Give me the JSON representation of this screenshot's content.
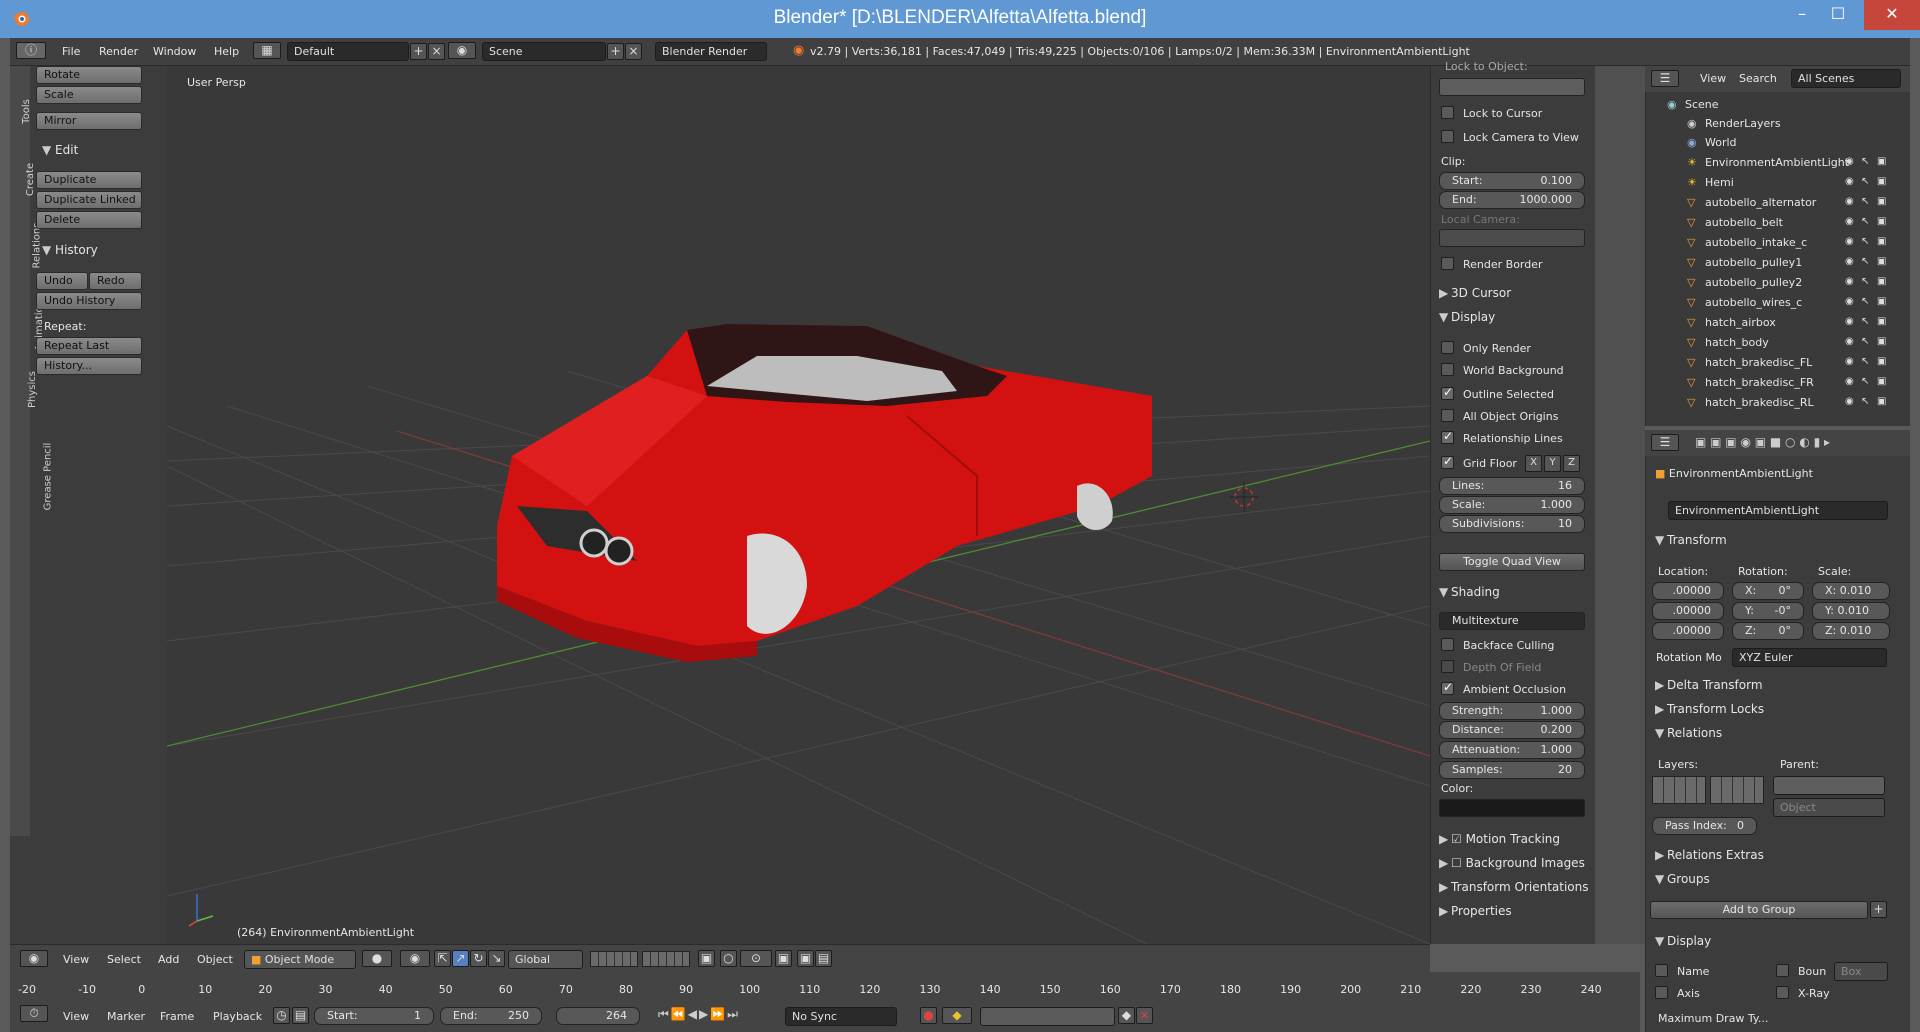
{
  "window": {
    "title": "Blender* [D:\\BLENDER\\Alfetta\\Alfetta.blend]"
  },
  "menu": {
    "items": [
      "File",
      "Render",
      "Window",
      "Help"
    ],
    "layout": "Default",
    "scene": "Scene",
    "engine": "Blender Render",
    "stats": "v2.79 | Verts:36,181 | Faces:47,049 | Tris:49,225 | Objects:0/106 | Lamps:0/2 | Mem:36.33M | EnvironmentAmbientLight"
  },
  "toolshelf": {
    "tabs": [
      "Tools",
      "Create",
      "Relations",
      "Animation",
      "Physics",
      "Grease Pencil"
    ],
    "transform_buttons": [
      "Rotate",
      "Scale"
    ],
    "mirror": "Mirror",
    "edit_header": "Edit",
    "edit_buttons": [
      "Duplicate",
      "Duplicate Linked",
      "Delete"
    ],
    "history_header": "History",
    "undo": "Undo",
    "redo": "Redo",
    "undo_history": "Undo History",
    "repeat_label": "Repeat:",
    "repeat_last": "Repeat Last",
    "history_more": "History..."
  },
  "viewport": {
    "label": "User Persp",
    "object_info": "(264) EnvironmentAmbientLight"
  },
  "npanel": {
    "lock_to_object": "Lock to Object:",
    "lock_to_cursor": "Lock to Cursor",
    "lock_camera": "Lock Camera to View",
    "clip_label": "Clip:",
    "clip_start_label": "Start:",
    "clip_start": "0.100",
    "clip_end_label": "End:",
    "clip_end": "1000.000",
    "local_camera": "Local Camera:",
    "render_border": "Render Border",
    "cursor_section": "3D Cursor",
    "display_section": "Display",
    "only_render": "Only Render",
    "world_background": "World Background",
    "outline_selected": "Outline Selected",
    "all_origins": "All Object Origins",
    "relationship_lines": "Relationship Lines",
    "grid_floor": "Grid Floor",
    "axis": [
      "X",
      "Y",
      "Z"
    ],
    "lines_label": "Lines:",
    "lines": "16",
    "scale_label": "Scale:",
    "scale": "1.000",
    "subdiv_label": "Subdivisions:",
    "subdiv": "10",
    "toggle_quad": "Toggle Quad View",
    "shading_section": "Shading",
    "shading_mode": "Multitexture",
    "backface": "Backface Culling",
    "dof": "Depth Of Field",
    "ao": "Ambient Occlusion",
    "strength_label": "Strength:",
    "strength": "1.000",
    "distance_label": "Distance:",
    "distance": "0.200",
    "atten_label": "Attenuation:",
    "atten": "1.000",
    "samples_label": "Samples:",
    "samples": "20",
    "color_label": "Color:",
    "motion_tracking": "Motion Tracking",
    "background_images": "Background Images",
    "transform_orient": "Transform Orientations",
    "properties": "Properties"
  },
  "outliner": {
    "view": "View",
    "search": "Search",
    "filter": "All Scenes",
    "rows": [
      {
        "name": "Scene"
      },
      {
        "name": "RenderLayers"
      },
      {
        "name": "World"
      },
      {
        "name": "EnvironmentAmbientLight"
      },
      {
        "name": "Hemi"
      },
      {
        "name": "autobello_alternator"
      },
      {
        "name": "autobello_belt"
      },
      {
        "name": "autobello_intake_c"
      },
      {
        "name": "autobello_pulley1"
      },
      {
        "name": "autobello_pulley2"
      },
      {
        "name": "autobello_wires_c"
      },
      {
        "name": "hatch_airbox"
      },
      {
        "name": "hatch_body"
      },
      {
        "name": "hatch_brakedisc_FL"
      },
      {
        "name": "hatch_brakedisc_FR"
      },
      {
        "name": "hatch_brakedisc_RL"
      }
    ]
  },
  "properties": {
    "breadcrumb": "EnvironmentAmbientLight",
    "object_name": "EnvironmentAmbientLight",
    "transform": "Transform",
    "location_label": "Location:",
    "rotation_label": "Rotation:",
    "scale_label": "Scale:",
    "loc": [
      ".00000",
      ".00000",
      ".00000"
    ],
    "rot_x": "X:",
    "rot_y": "Y:",
    "rot_z": "Z:",
    "rot": [
      "0°",
      "-0°",
      "0°"
    ],
    "scl": [
      "X: 0.010",
      "Y: 0.010",
      "Z: 0.010"
    ],
    "rotation_mode_label": "Rotation Mo",
    "rotation_mode": "XYZ Euler",
    "delta_transform": "Delta Transform",
    "transform_locks": "Transform Locks",
    "relations": "Relations",
    "layers_label": "Layers:",
    "parent_label": "Parent:",
    "parent_type": "Object",
    "pass_index_label": "Pass Index:",
    "pass_index": "0",
    "relations_extras": "Relations Extras",
    "groups": "Groups",
    "add_to_group": "Add to Group",
    "display": "Display",
    "name": "Name",
    "bounds": "Boun",
    "box": "Box",
    "axis": "Axis",
    "xray": "X-Ray",
    "max_draw": "Maximum Draw Ty..."
  },
  "viewport_header": {
    "view": "View",
    "select": "Select",
    "add": "Add",
    "object": "Object",
    "mode": "Object Mode",
    "orientation": "Global"
  },
  "timeline": {
    "ticks": [
      "-20",
      "-10",
      "0",
      "10",
      "20",
      "30",
      "40",
      "50",
      "60",
      "70",
      "80",
      "90",
      "100",
      "110",
      "120",
      "130",
      "140",
      "150",
      "160",
      "170",
      "180",
      "190",
      "200",
      "210",
      "220",
      "230",
      "240"
    ],
    "view": "View",
    "marker": "Marker",
    "frame": "Frame",
    "playback": "Playback",
    "start_label": "Start:",
    "start": "1",
    "end_label": "End:",
    "end": "250",
    "current": "264",
    "sync": "No Sync"
  }
}
